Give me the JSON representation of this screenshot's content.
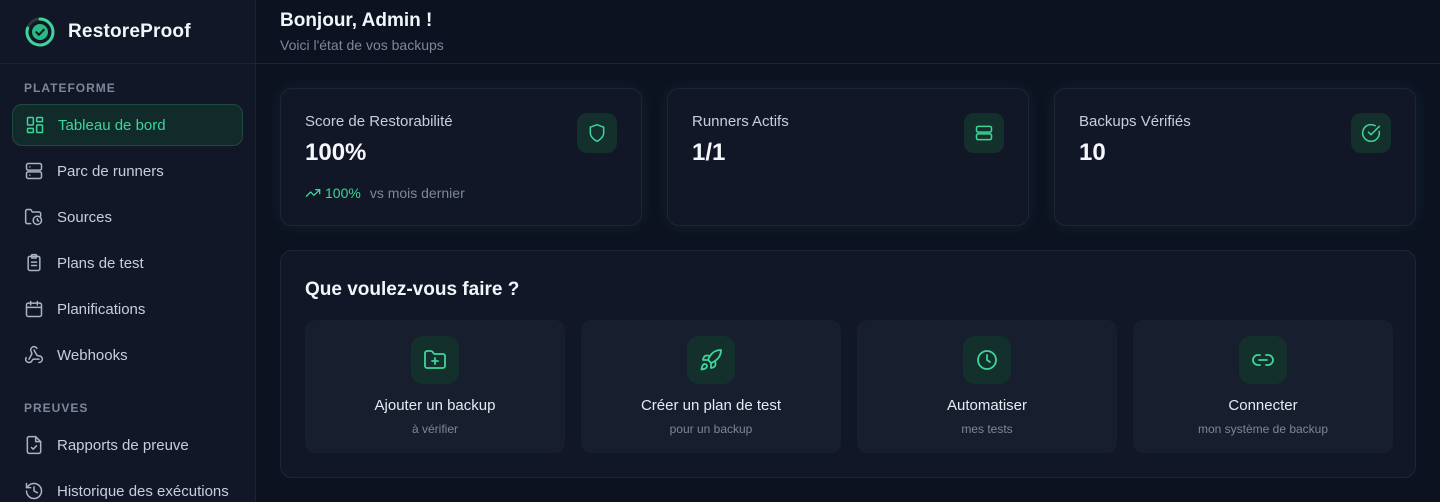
{
  "brand": {
    "name": "RestoreProof"
  },
  "sidebar": {
    "sections": [
      {
        "title": "PLATEFORME"
      },
      {
        "title": "PREUVES"
      }
    ],
    "items": [
      {
        "label": "Tableau de bord",
        "icon": "dashboard-icon"
      },
      {
        "label": "Parc de runners",
        "icon": "server-icon"
      },
      {
        "label": "Sources",
        "icon": "folder-clock-icon"
      },
      {
        "label": "Plans de test",
        "icon": "clipboard-list-icon"
      },
      {
        "label": "Planifications",
        "icon": "calendar-icon"
      },
      {
        "label": "Webhooks",
        "icon": "webhook-icon"
      },
      {
        "label": "Rapports de preuve",
        "icon": "file-check-icon"
      },
      {
        "label": "Historique des exécutions",
        "icon": "history-icon"
      }
    ]
  },
  "header": {
    "greeting": "Bonjour, Admin !",
    "subtitle": "Voici l'état de vos backups"
  },
  "stats": [
    {
      "label": "Score de Restorabilité",
      "value": "100%",
      "trend_pct": "100%",
      "trend_text": "vs mois dernier",
      "icon": "shield-icon"
    },
    {
      "label": "Runners Actifs",
      "value": "1/1",
      "icon": "server-icon"
    },
    {
      "label": "Backups Vérifiés",
      "value": "10",
      "icon": "circle-check-icon"
    }
  ],
  "actions": {
    "title": "Que voulez-vous faire ?",
    "items": [
      {
        "label": "Ajouter un backup",
        "sub": "à vérifier",
        "icon": "folder-plus-icon"
      },
      {
        "label": "Créer un plan de test",
        "sub": "pour un backup",
        "icon": "rocket-icon"
      },
      {
        "label": "Automatiser",
        "sub": "mes tests",
        "icon": "clock-icon"
      },
      {
        "label": "Connecter",
        "sub": "mon système de backup",
        "icon": "link-icon"
      }
    ]
  },
  "colors": {
    "accent": "#3ed598",
    "background": "#0d1220",
    "panel": "#111726",
    "muted_text": "#7d8799"
  }
}
